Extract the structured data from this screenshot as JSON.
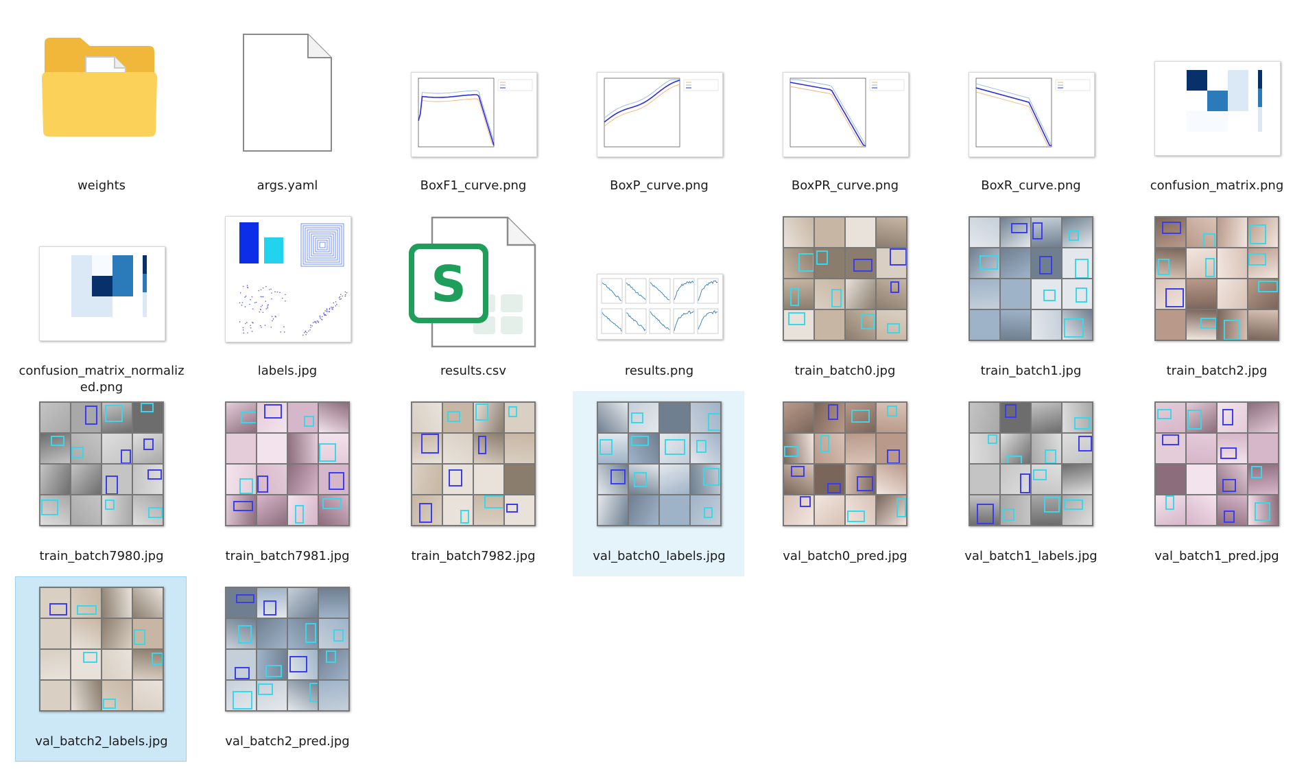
{
  "items": [
    {
      "name": "weights",
      "kind": "folder"
    },
    {
      "name": "args.yaml",
      "kind": "file"
    },
    {
      "name": "BoxF1_curve.png",
      "kind": "curve"
    },
    {
      "name": "BoxP_curve.png",
      "kind": "curve"
    },
    {
      "name": "BoxPR_curve.png",
      "kind": "curve"
    },
    {
      "name": "BoxR_curve.png",
      "kind": "curve"
    },
    {
      "name": "confusion_matrix.png",
      "kind": "matrix"
    },
    {
      "name": "confusion_matrix_normalized.png",
      "kind": "matrix"
    },
    {
      "name": "labels.jpg",
      "kind": "labels"
    },
    {
      "name": "results.csv",
      "kind": "spreadsheet"
    },
    {
      "name": "results.png",
      "kind": "results"
    },
    {
      "name": "train_batch0.jpg",
      "kind": "photos"
    },
    {
      "name": "train_batch1.jpg",
      "kind": "photos"
    },
    {
      "name": "train_batch2.jpg",
      "kind": "photos"
    },
    {
      "name": "train_batch7980.jpg",
      "kind": "photos"
    },
    {
      "name": "train_batch7981.jpg",
      "kind": "photos"
    },
    {
      "name": "train_batch7982.jpg",
      "kind": "photos"
    },
    {
      "name": "val_batch0_labels.jpg",
      "kind": "photos",
      "state": "hover"
    },
    {
      "name": "val_batch0_pred.jpg",
      "kind": "photos"
    },
    {
      "name": "val_batch1_labels.jpg",
      "kind": "photos"
    },
    {
      "name": "val_batch1_pred.jpg",
      "kind": "photos"
    },
    {
      "name": "val_batch2_labels.jpg",
      "kind": "photos",
      "state": "selected"
    },
    {
      "name": "val_batch2_pred.jpg",
      "kind": "photos"
    }
  ],
  "colors": {
    "folder_back": "#f0b73a",
    "folder_front": "#fbd15a",
    "spreadsheet_green": "#1e9e5a",
    "series_blue": "#2a2ae0",
    "series_light_blue": "#8fb5e8",
    "series_orange": "#f2b27a",
    "heat_dark": "#08306b",
    "heat_mid": "#2b7bba",
    "heat_light": "#dbe9f6",
    "label_cyan": "#22d3ee"
  }
}
